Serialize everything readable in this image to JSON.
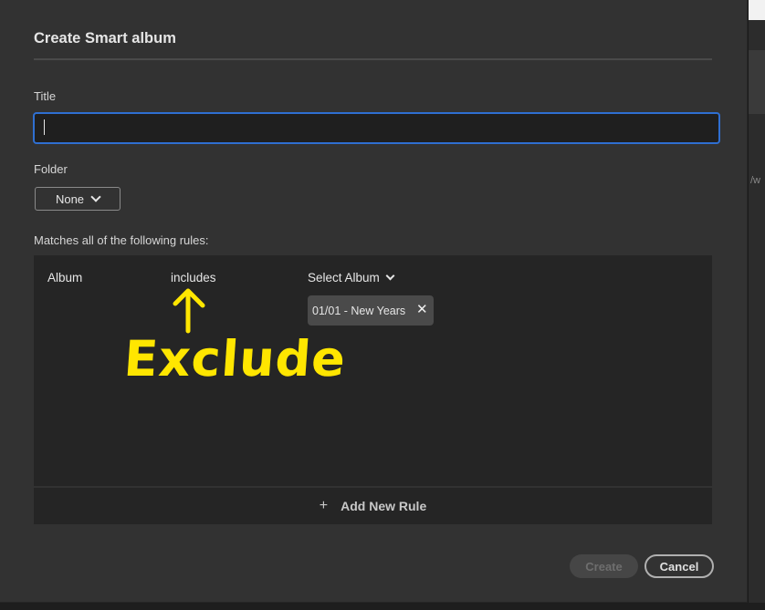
{
  "dialog": {
    "title": "Create Smart album",
    "title_label": "Title",
    "title_value": "",
    "folder_label": "Folder",
    "folder_value": "None",
    "rules_label": "Matches all of the following rules:",
    "rule": {
      "field": "Album",
      "operator": "includes",
      "value_select": "Select Album",
      "selected_tag": "01/01 - New Years"
    },
    "add_rule_label": "Add New Rule",
    "create_label": "Create",
    "cancel_label": "Cancel"
  },
  "annotation": {
    "text": "Exclude",
    "color": "#ffe600"
  },
  "colors": {
    "dialog_bg": "#323232",
    "focus_border": "#2f6fd1",
    "rules_bg": "#252525"
  },
  "icons": {
    "folder_dropdown": "chevron-down-icon",
    "album_dropdown": "chevron-down-icon",
    "tag_remove": "close-icon",
    "add_rule": "plus-icon",
    "annotation_arrow": "arrow-up-icon"
  }
}
